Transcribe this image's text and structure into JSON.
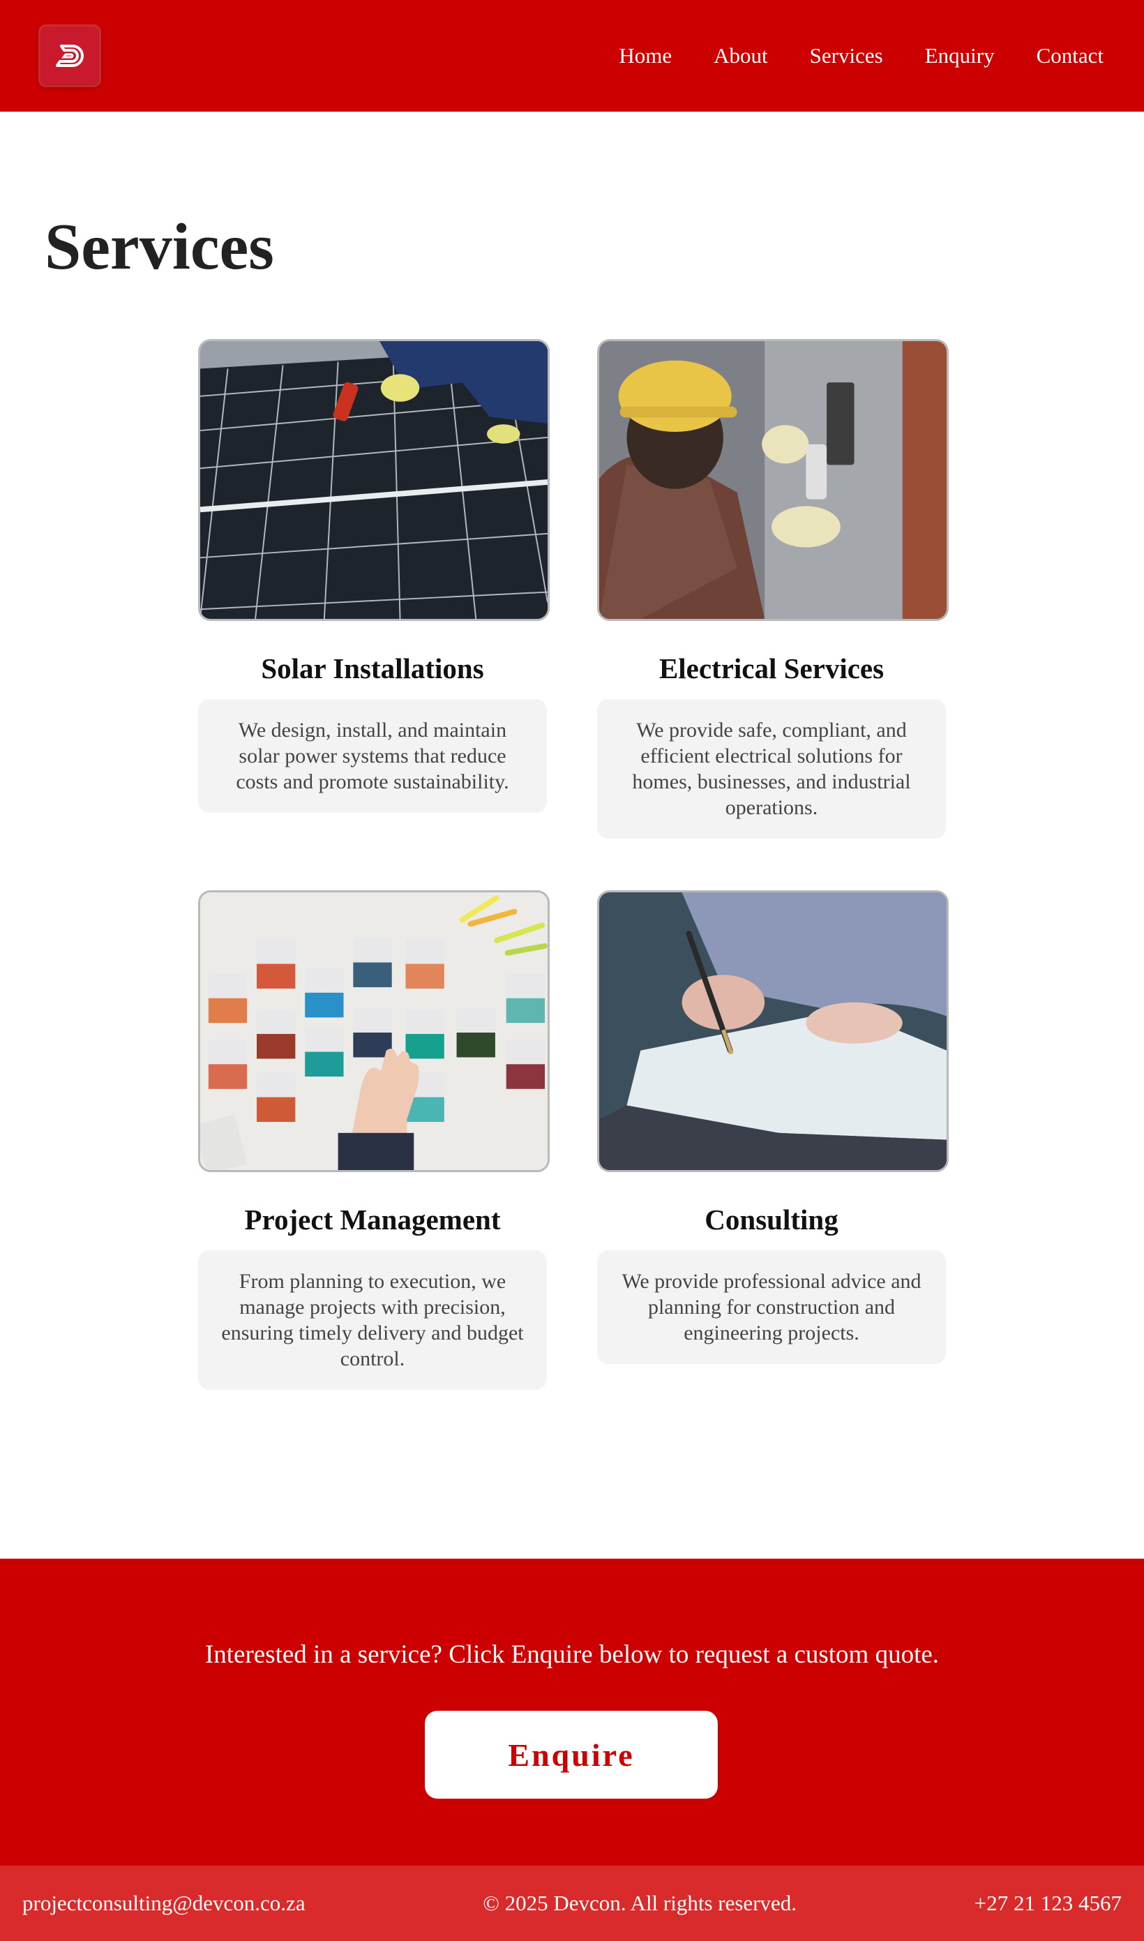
{
  "nav": {
    "logo_icon": "devcon-logo-icon",
    "items": [
      {
        "label": "Home"
      },
      {
        "label": "About"
      },
      {
        "label": "Services"
      },
      {
        "label": "Enquiry"
      },
      {
        "label": "Contact"
      }
    ]
  },
  "page": {
    "title": "Services"
  },
  "services": [
    {
      "title": "Solar Installations",
      "description": "We design, install, and maintain solar power systems that reduce costs and promote sustainability.",
      "image": "solar-panel-photo"
    },
    {
      "title": "Electrical Services",
      "description": "We provide safe, compliant, and efficient electrical solutions for homes, businesses, and industrial operations.",
      "image": "electrician-photo"
    },
    {
      "title": "Project Management",
      "description": "From planning to execution, we manage projects with precision, ensuring timely delivery and budget control.",
      "image": "planning-cards-photo"
    },
    {
      "title": "Consulting",
      "description": "We provide professional advice and planning for construction and engineering projects.",
      "image": "drafting-photo"
    }
  ],
  "cta": {
    "text": "Interested in a service? Click Enquire below to request a custom quote.",
    "button_label": "Enquire"
  },
  "footer": {
    "email": "projectconsulting@devcon.co.za",
    "copyright": "© 2025 Devcon. All rights reserved.",
    "phone": "+27 21 123 4567"
  },
  "colors": {
    "brand_red": "#cc0000",
    "footer_red": "#d92b2b",
    "card_bg": "#f3f3f3"
  }
}
